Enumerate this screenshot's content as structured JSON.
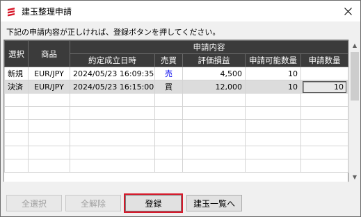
{
  "window": {
    "title": "建玉整理申請"
  },
  "instruction": "下記の申請内容が正しければ、登録ボタンを押してください。",
  "table": {
    "group_header": "申請内容",
    "headers": {
      "select": "選択",
      "product": "商品",
      "exec_time": "約定成立日時",
      "side": "売買",
      "pl": "評価損益",
      "available": "申請可能数量",
      "qty": "申請数量"
    },
    "rows": [
      {
        "select": "新規",
        "product": "EUR/JPY",
        "exec_time": "2024/05/23 16:09:35",
        "side": "売",
        "pl": "4,500",
        "available": "10",
        "qty": ""
      },
      {
        "select": "決済",
        "product": "EUR/JPY",
        "exec_time": "2024/05/23 16:15:00",
        "side": "買",
        "pl": "12,000",
        "available": "10",
        "qty": "10"
      }
    ]
  },
  "buttons": {
    "select_all": "全選択",
    "deselect_all": "全解除",
    "register": "登録",
    "position_list": "建玉一覧へ"
  }
}
